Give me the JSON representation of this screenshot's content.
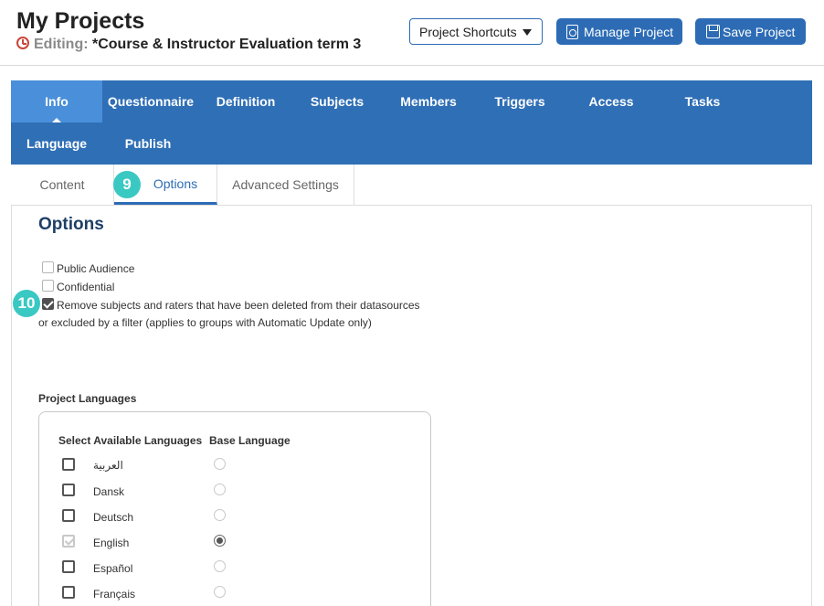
{
  "header": {
    "title": "My Projects",
    "editing_label": "Editing:",
    "project_name": "*Course & Instructor Evaluation term 3",
    "shortcuts_label": "Project Shortcuts",
    "manage_label": "Manage Project",
    "save_label": "Save Project"
  },
  "nav": {
    "items": [
      "Info",
      "Questionnaire",
      "Definition",
      "Subjects",
      "Members",
      "Triggers",
      "Access",
      "Tasks",
      "Language",
      "Publish"
    ],
    "active": "Info"
  },
  "subtabs": {
    "items": [
      "Content",
      "Options",
      "Advanced Settings"
    ],
    "active": "Options"
  },
  "badges": {
    "options_tab": "9",
    "remove_option": "10"
  },
  "options": {
    "title": "Options",
    "public_audience": "Public Audience",
    "confidential": "Confidential",
    "remove_line1": "Remove subjects and raters that have been deleted from their datasources",
    "remove_line2": "or excluded by a filter (applies to groups with Automatic Update only)"
  },
  "languages": {
    "heading": "Project Languages",
    "col_select": "Select Available Languages",
    "col_base": "Base Language",
    "items": [
      {
        "name": "العربية",
        "selected": false,
        "base": false
      },
      {
        "name": "Dansk",
        "selected": false,
        "base": false
      },
      {
        "name": "Deutsch",
        "selected": false,
        "base": false
      },
      {
        "name": "English",
        "selected": true,
        "base": true
      },
      {
        "name": "Español",
        "selected": false,
        "base": false
      },
      {
        "name": "Français",
        "selected": false,
        "base": false
      }
    ]
  }
}
